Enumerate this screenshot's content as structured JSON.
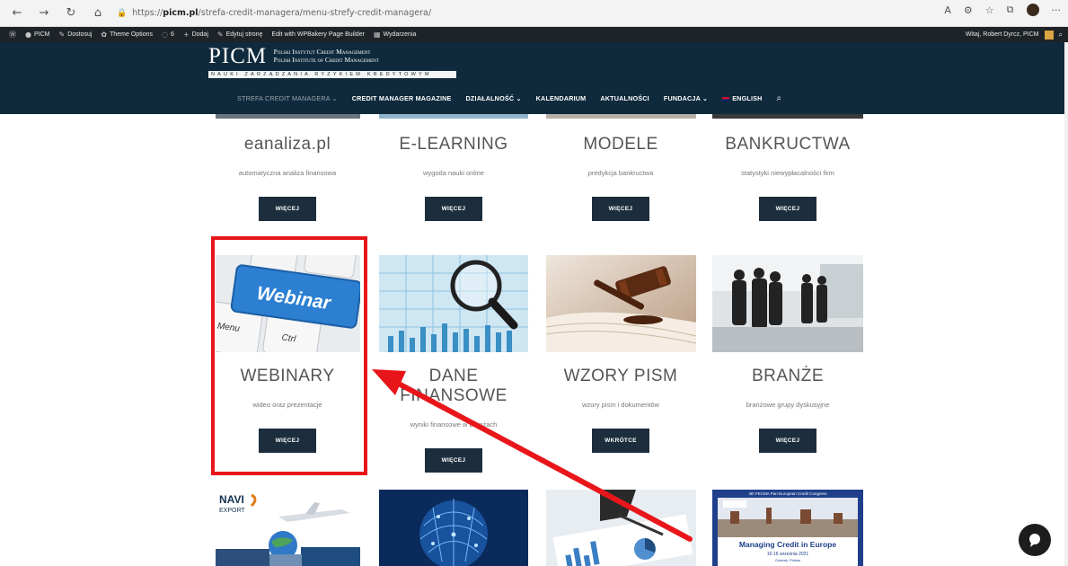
{
  "browser": {
    "url_prefix": "https://",
    "url_host": "picm.pl",
    "url_path": "/strefa-credit-managera/menu-strefy-credit-managera/",
    "icons": [
      "back-icon",
      "forward-icon",
      "reload-icon",
      "home-icon",
      "lock-icon"
    ]
  },
  "wp_admin": {
    "items": [
      {
        "icon": "●",
        "label": "PICM"
      },
      {
        "icon": "✎",
        "label": "Dostosuj"
      },
      {
        "icon": "✿",
        "label": "Theme Options"
      },
      {
        "icon": "◌",
        "label": "6"
      },
      {
        "icon": "+",
        "label": "Dodaj"
      },
      {
        "icon": "✎",
        "label": "Edytuj stronę"
      },
      {
        "icon": "",
        "label": "Edit with WPBakery Page Builder"
      },
      {
        "icon": "▦",
        "label": "Wydarzenia"
      }
    ],
    "user": "Witaj, Robert Dyrcz, PICM"
  },
  "header": {
    "logo_main": "PICM",
    "logo_line1": "Polski Instytut Credit Management",
    "logo_line2": "Polish Institute of Credit Management",
    "logo_tag": "NAUKI ZARZĄDZANIA RYZYKIEM KREDYTOWYM",
    "nav": [
      {
        "label": "STREFA CREDIT MANAGERA ⌄",
        "active": true
      },
      {
        "label": "CREDIT MANAGER MAGAZINE",
        "active": false
      },
      {
        "label": "DZIAŁALNOŚĆ ⌄",
        "active": false
      },
      {
        "label": "KALENDARIUM",
        "active": false
      },
      {
        "label": "AKTUALNOŚCI",
        "active": false
      },
      {
        "label": "FUNDACJA ⌄",
        "active": false
      },
      {
        "label": "ENGLISH",
        "active": false
      }
    ]
  },
  "row1": [
    {
      "title": "eanaliza.pl",
      "desc": "automatyczna analiza finansowa",
      "button": "WIĘCEJ"
    },
    {
      "title": "E-LEARNING",
      "desc": "wygoda nauki online",
      "button": "WIĘCEJ"
    },
    {
      "title": "MODELE",
      "desc": "predykcja bankructwa",
      "button": "WIĘCEJ"
    },
    {
      "title": "BANKRUCTWA",
      "desc": "statystyki niewypłacalności firm",
      "button": "WIĘCEJ"
    }
  ],
  "row2": [
    {
      "title": "WEBINARY",
      "desc": "wideo oraz prezentacje",
      "button": "WIĘCEJ",
      "image": "webinar-keyboard"
    },
    {
      "title": "DANE FINANSOWE",
      "desc": "wyniki finansowe w branżach",
      "button": "WIĘCEJ",
      "image": "magnifier-charts"
    },
    {
      "title": "WZORY PISM",
      "desc": "wzory pism i dokumentów",
      "button": "WKRÓTCE",
      "image": "gavel-book"
    },
    {
      "title": "BRANŻE",
      "desc": "branżowe grupy dyskusyjne",
      "button": "WIĘCEJ",
      "image": "people-meeting"
    }
  ],
  "row3": [
    {
      "image": "navi-export-transport",
      "logo_text": "NAVI",
      "logo_sub": "EXPORT"
    },
    {
      "image": "digital-brain"
    },
    {
      "image": "hand-charts"
    },
    {
      "image": "congress-banner",
      "banner_top": "4th FECMA Pan-European Credit Congress",
      "banner_title": "Managing Credit in Europe",
      "banner_date": "15-16 września 2021",
      "banner_place": "Gdańsk, Polska"
    }
  ],
  "webinar_key": {
    "main": "Webinar",
    "left": "Menu",
    "bottom": "Ctrl"
  },
  "annotation": {
    "color": "#e8161b"
  }
}
